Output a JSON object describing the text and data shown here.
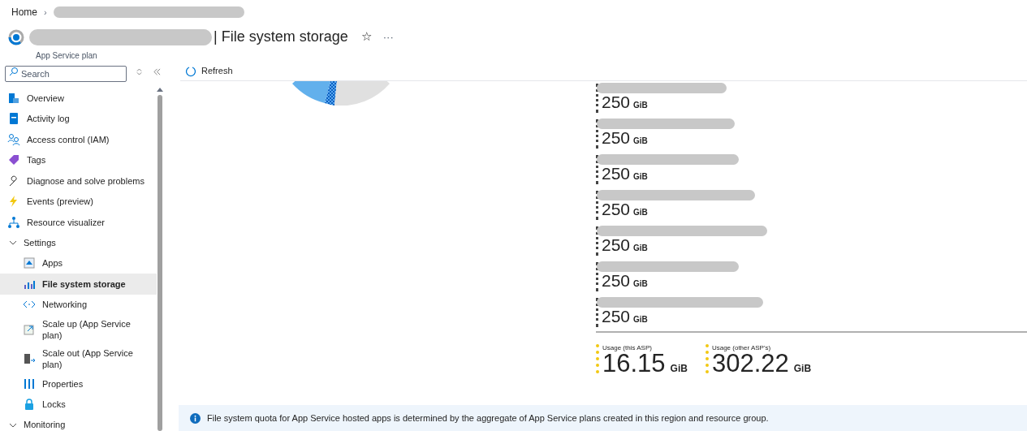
{
  "breadcrumb": {
    "home": "Home",
    "separator": "›"
  },
  "header": {
    "title": "| File system storage",
    "subtitle": "App Service plan",
    "star": "☆",
    "more": "···"
  },
  "sidebar": {
    "search": {
      "placeholder": "Search"
    },
    "items": [
      {
        "label": "Overview",
        "selected": false
      },
      {
        "label": "Activity log",
        "selected": false
      },
      {
        "label": "Access control (IAM)",
        "selected": false
      },
      {
        "label": "Tags",
        "selected": false
      },
      {
        "label": "Diagnose and solve problems",
        "selected": false
      },
      {
        "label": "Events (preview)",
        "selected": false
      },
      {
        "label": "Resource visualizer",
        "selected": false
      },
      {
        "label": "Settings",
        "kind": "group",
        "expanded": true,
        "children": [
          {
            "label": "Apps",
            "selected": false
          },
          {
            "label": "File system storage",
            "selected": true
          },
          {
            "label": "Networking",
            "selected": false
          },
          {
            "label": "Scale up (App Service plan)",
            "selected": false
          },
          {
            "label": "Scale out (App Service plan)",
            "selected": false
          },
          {
            "label": "Properties",
            "selected": false
          },
          {
            "label": "Locks",
            "selected": false
          }
        ]
      },
      {
        "label": "Monitoring",
        "kind": "group",
        "expanded": true
      }
    ]
  },
  "toolbar": {
    "refresh": "Refresh"
  },
  "legend": [
    {
      "value": "250",
      "unit": "GiB"
    },
    {
      "value": "250",
      "unit": "GiB"
    },
    {
      "value": "250",
      "unit": "GiB"
    },
    {
      "value": "250",
      "unit": "GiB"
    },
    {
      "value": "250",
      "unit": "GiB"
    },
    {
      "value": "250",
      "unit": "GiB"
    },
    {
      "value": "250",
      "unit": "GiB"
    }
  ],
  "usage": [
    {
      "label": "Usage (this ASP)",
      "value": "16.15",
      "unit": "GiB",
      "color": "#f2c811"
    },
    {
      "label": "Usage (other ASP's)",
      "value": "302.22",
      "unit": "GiB",
      "color": "#f2c811"
    }
  ],
  "info": {
    "text": "File system quota for App Service hosted apps is determined by the aggregate of App Service plans created in this region and resource group."
  }
}
